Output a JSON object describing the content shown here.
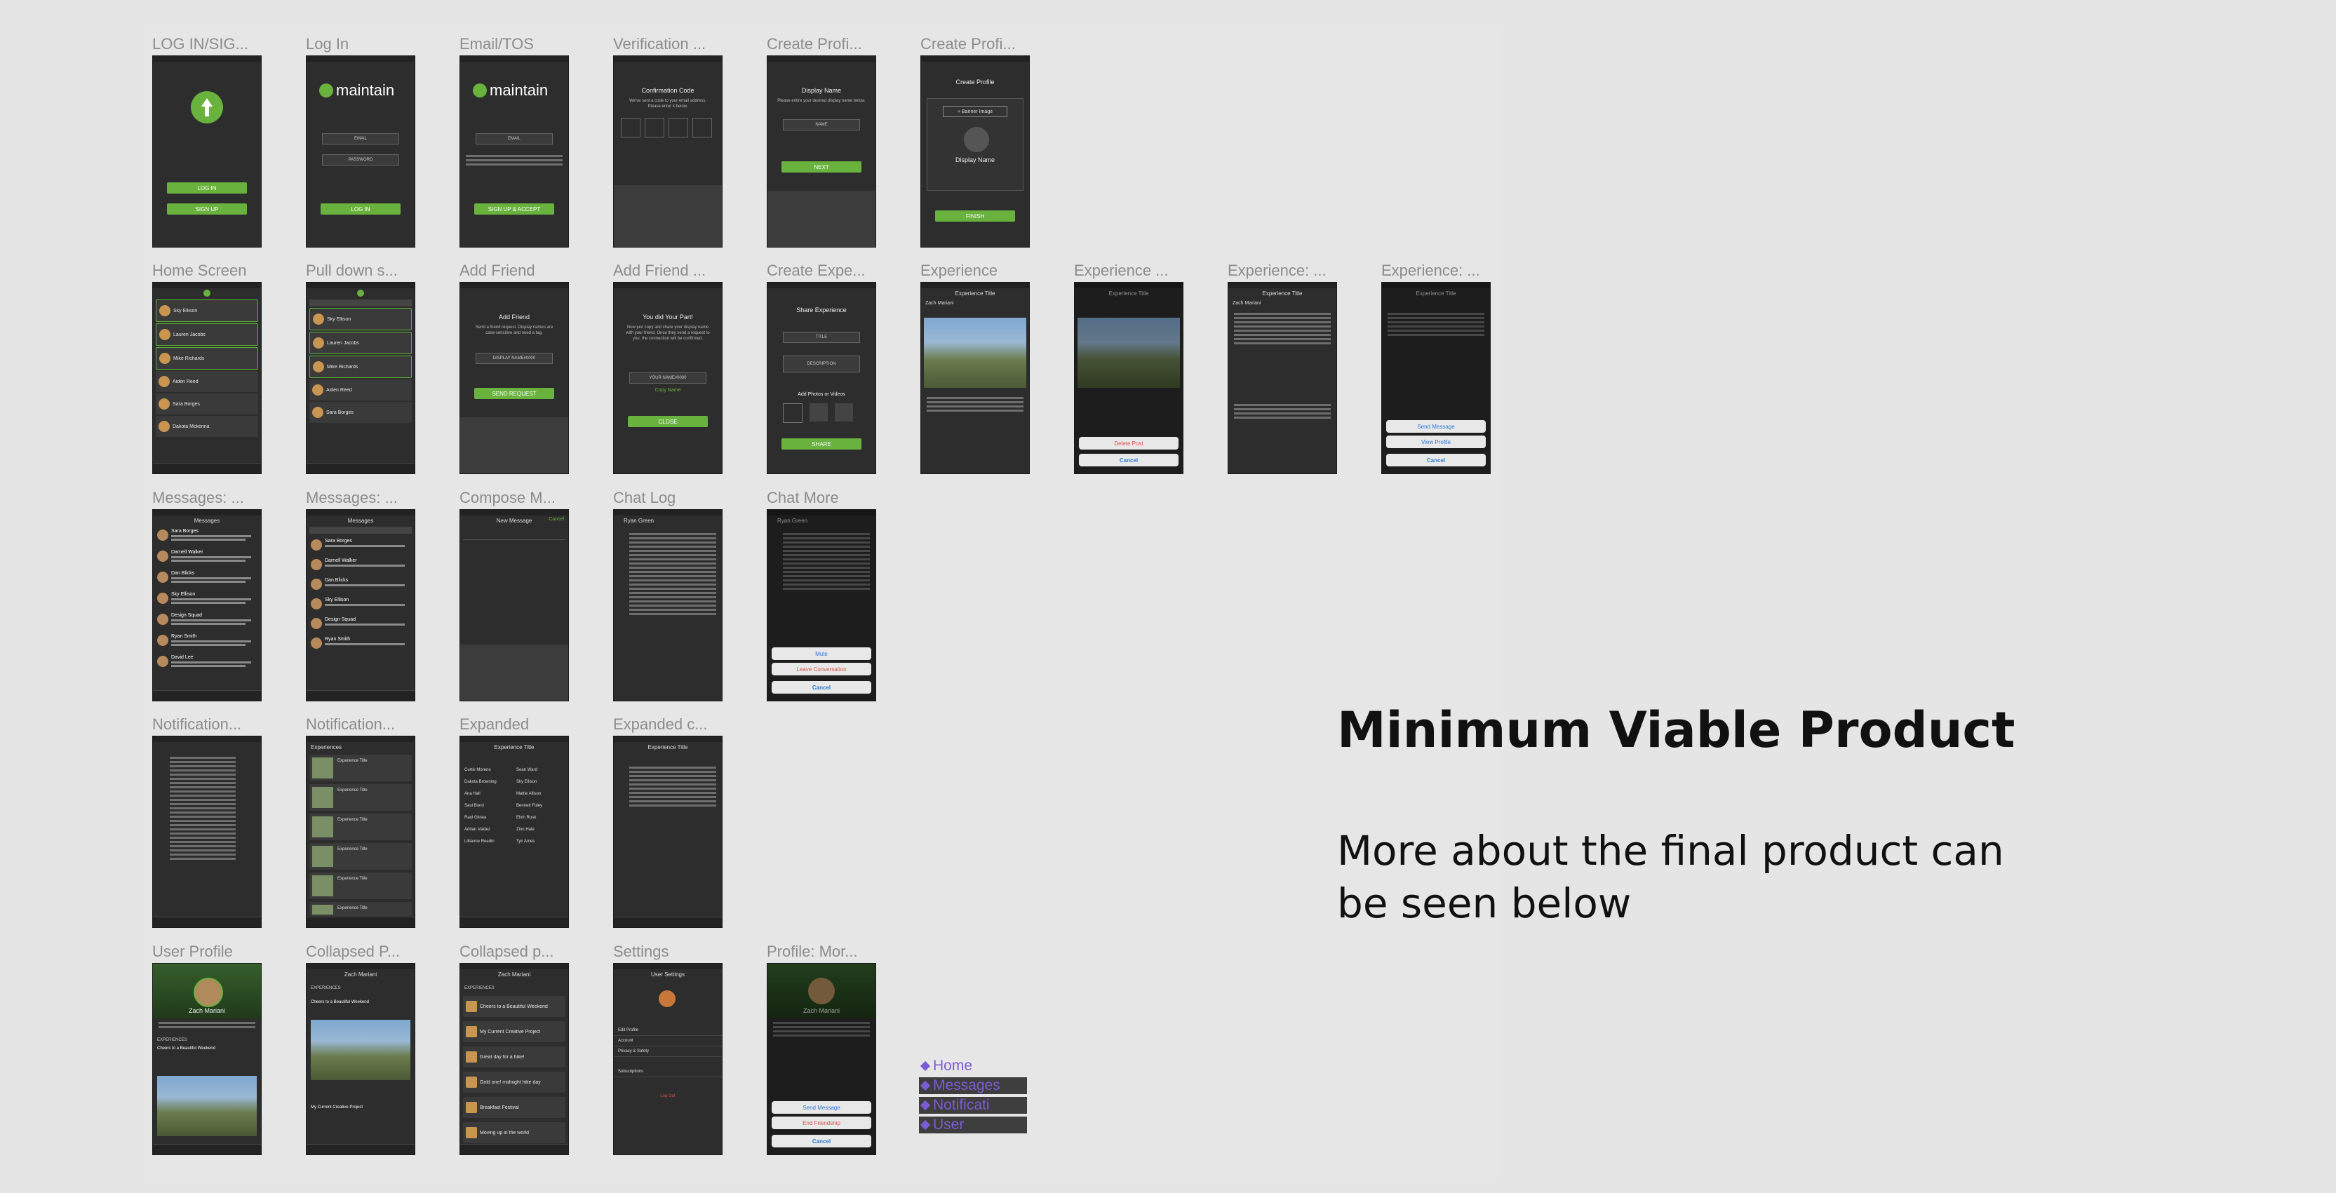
{
  "frames": [
    {
      "label": "LOG IN/SIG..."
    },
    {
      "label": "Log In"
    },
    {
      "label": "Email/TOS"
    },
    {
      "label": "Verification ..."
    },
    {
      "label": "Create Profi..."
    },
    {
      "label": "Create Profi..."
    },
    {
      "label": "Home Screen"
    },
    {
      "label": "Pull down s..."
    },
    {
      "label": "Add Friend"
    },
    {
      "label": "Add Friend ..."
    },
    {
      "label": "Create Expe..."
    },
    {
      "label": "Experience"
    },
    {
      "label": "Experience ..."
    },
    {
      "label": "Experience: ..."
    },
    {
      "label": "Experience: ..."
    },
    {
      "label": "Messages: ..."
    },
    {
      "label": "Messages: ..."
    },
    {
      "label": "Compose M..."
    },
    {
      "label": "Chat Log"
    },
    {
      "label": "Chat More"
    },
    {
      "label": "Notification..."
    },
    {
      "label": "Notification..."
    },
    {
      "label": "Expanded"
    },
    {
      "label": "Expanded c..."
    },
    {
      "label": "User Profile"
    },
    {
      "label": "Collapsed P..."
    },
    {
      "label": "Collapsed p..."
    },
    {
      "label": "Settings"
    },
    {
      "label": "Profile: Mor..."
    }
  ],
  "screens": {
    "login": {
      "login_btn": "LOG IN",
      "signup_btn": "SIGN UP"
    },
    "logo_text": "maintain",
    "log_in": {
      "email": "EMAIL",
      "password": "PASSWORD",
      "btn": "LOG IN"
    },
    "email_tos": {
      "email": "EMAIL",
      "btn": "SIGN UP & ACCEPT"
    },
    "verification": {
      "title": "Confirmation Code",
      "desc": "We've sent a code to your email address. Please enter it below."
    },
    "create_profile": {
      "title": "Display Name",
      "desc": "Please entire your desired display name below.",
      "field": "NAME",
      "btn": "NEXT"
    },
    "create_profile2": {
      "title": "Create Profile",
      "banner": "+ Banner Image",
      "display": "Display Name",
      "finish": "FINISH"
    },
    "home_rows": [
      "Sky Ellison",
      "Lauren Jacobs",
      "Mike Richards",
      "Aiden Reed",
      "Sara Borges",
      "Dakota Mckenna"
    ],
    "add_friend": {
      "title": "Add Friend",
      "desc": "Send a friend request. Display names are case-sensitive and need a tag.",
      "field": "DISPLAY NAME#0000",
      "btn": "SEND REQUEST"
    },
    "add_friend_done": {
      "title": "You did Your Part!",
      "desc": "Now just copy and share your display name with your friend. Once they send a request to you, the connection will be confirmed.",
      "field": "YOUR NAME#0000",
      "link": "Copy Name",
      "btn": "CLOSE"
    },
    "create_exp": {
      "title": "Share Experience",
      "f1": "TITLE",
      "f2": "DESCRIPTION",
      "add": "Add Photos or Videos",
      "btn": "SHARE"
    },
    "experience_title": "Experience Title",
    "experience_user": "Zach Mariani",
    "delete_post": "Delete Post",
    "cancel": "Cancel",
    "send_message": "Send Message",
    "view_profile": "View Profile",
    "messages": {
      "title": "Messages",
      "rows": [
        "Sara Borges",
        "Darnell Walker",
        "Dan Blicks",
        "Sky Ellison",
        "Design Squad",
        "Ryan Smith",
        "David Lee"
      ]
    },
    "compose": {
      "title": "New Message",
      "cancel": "Cancel"
    },
    "chat": {
      "user": "Ryan Green"
    },
    "chat_more": {
      "mute": "Mute",
      "leave": "Leave Conversation",
      "cancel": "Cancel"
    },
    "notifications": {
      "title": "Experiences"
    },
    "expanded_names": [
      "Curtis Moreno",
      "Dakota Browning",
      "Ana Hall",
      "Saul Bond",
      "Raul Glinea",
      "Adrian Valdez",
      "Lillianne Reedin",
      "Sean Ward",
      "Sky Ellison",
      "Mattie Allison",
      "Bennett Foley",
      "Elvin Rusk",
      "Zion Hale",
      "Tyn Ames"
    ],
    "user_profile": {
      "name": "Zach Mariani",
      "section": "EXPERIENCES",
      "card": "Cheers to a Beautiful Weekend"
    },
    "collapsed_items": [
      "Cheers to a Beautiful Weekend",
      "My Current Creative Project",
      "Great day for a hike!",
      "Gold one! midnight hike day",
      "Breakfast Festival",
      "Moving up in the world"
    ],
    "settings": {
      "title": "User Settings",
      "items": [
        "Edit Profile",
        "Account",
        "Privacy & Safety",
        "Subscriptions"
      ],
      "logout": "Log Out"
    },
    "profile_more": {
      "send": "Send Message",
      "end": "End Friendship",
      "cancel": "Cancel"
    }
  },
  "nav": [
    {
      "label": "Home"
    },
    {
      "label": "Messages"
    },
    {
      "label": "Notificati"
    },
    {
      "label": "User"
    }
  ],
  "heading": {
    "title": "Minimum Viable Product",
    "subtitle": "More about the final product can be seen below"
  },
  "colors": {
    "accent_green": "#6ab23e",
    "nav_purple": "#7b5cd6",
    "phone_bg": "#2d2d2d"
  }
}
